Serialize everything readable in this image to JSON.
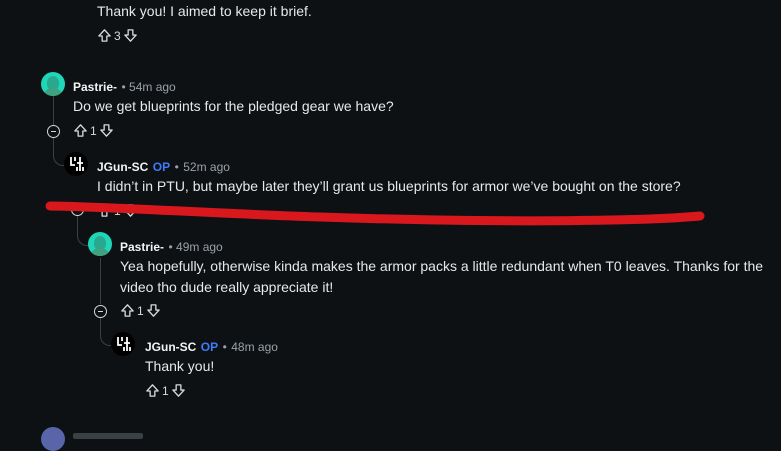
{
  "comments": [
    {
      "body": "Thank you! I aimed to keep it brief.",
      "score": "3"
    },
    {
      "author": "Pastrie-",
      "time": "54m ago",
      "body": "Do we get blueprints for the pledged gear we have?",
      "score": "1"
    },
    {
      "author": "JGun-SC",
      "op": "OP",
      "time": "52m ago",
      "body": "I didn’t in PTU, but maybe later they’ll grant us blueprints for armor we’ve bought on the store?",
      "score": "1"
    },
    {
      "author": "Pastrie-",
      "time": "49m ago",
      "body": "Yea hopefully, otherwise kinda makes the armor packs a little redundant when T0 leaves. Thanks for the video tho dude really appreciate it!",
      "score": "1"
    },
    {
      "author": "JGun-SC",
      "op": "OP",
      "time": "48m ago",
      "body": "Thank you!",
      "score": "1"
    }
  ],
  "annotation_color": "#d8181c",
  "accent_op_color": "#3b7dff"
}
